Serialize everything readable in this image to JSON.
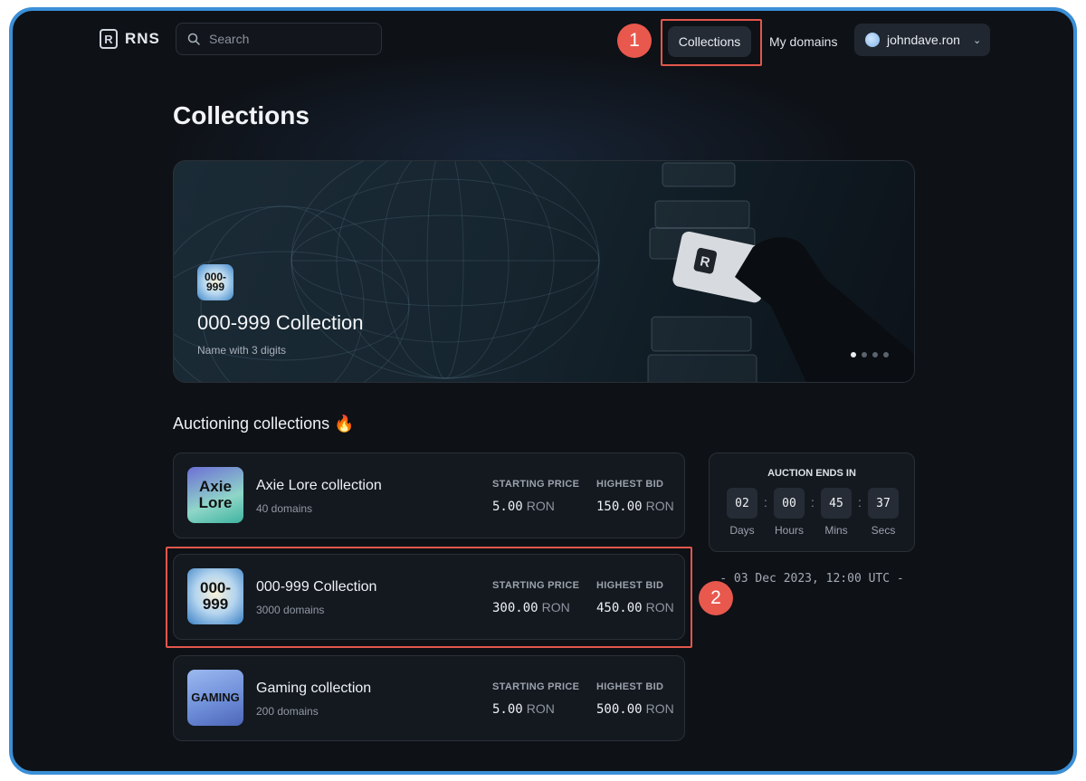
{
  "header": {
    "logo_text": "RNS",
    "logo_mark": "R",
    "search_placeholder": "Search",
    "nav_collections": "Collections",
    "nav_my_domains": "My domains",
    "user_name": "johndave.ron"
  },
  "annotations": {
    "badge1": "1",
    "badge2": "2"
  },
  "page_title": "Collections",
  "banner": {
    "icon_text_top": "000-",
    "icon_text_bottom": "999",
    "title": "000-999 Collection",
    "subtitle": "Name with 3 digits",
    "slide_count": 4,
    "active_slide": 1
  },
  "auction_section_title": "Auctioning collections 🔥",
  "collections": [
    {
      "name": "Axie Lore collection",
      "count": "40 domains",
      "thumb_top": "Axie",
      "thumb_bottom": "Lore",
      "starting_price_label": "STARTING PRICE",
      "starting_price": "5.00",
      "highest_bid_label": "HIGHEST BID",
      "highest_bid": "150.00",
      "unit": "RON"
    },
    {
      "name": "000-999 Collection",
      "count": "3000 domains",
      "thumb_top": "000-",
      "thumb_bottom": "999",
      "starting_price_label": "STARTING PRICE",
      "starting_price": "300.00",
      "highest_bid_label": "HIGHEST BID",
      "highest_bid": "450.00",
      "unit": "RON"
    },
    {
      "name": "Gaming collection",
      "count": "200 domains",
      "thumb_top": "GAMING",
      "thumb_bottom": "",
      "starting_price_label": "STARTING PRICE",
      "starting_price": "5.00",
      "highest_bid_label": "HIGHEST BID",
      "highest_bid": "500.00",
      "unit": "RON"
    }
  ],
  "countdown": {
    "title": "AUCTION ENDS IN",
    "days": "02",
    "hours": "00",
    "mins": "45",
    "secs": "37",
    "days_label": "Days",
    "hours_label": "Hours",
    "mins_label": "Mins",
    "secs_label": "Secs",
    "end_date": "- 03 Dec 2023, 12:00 UTC -"
  },
  "colors": {
    "annotation_red": "#e2574c",
    "frame_blue": "#3b8fd6",
    "background": "#0e1116"
  }
}
